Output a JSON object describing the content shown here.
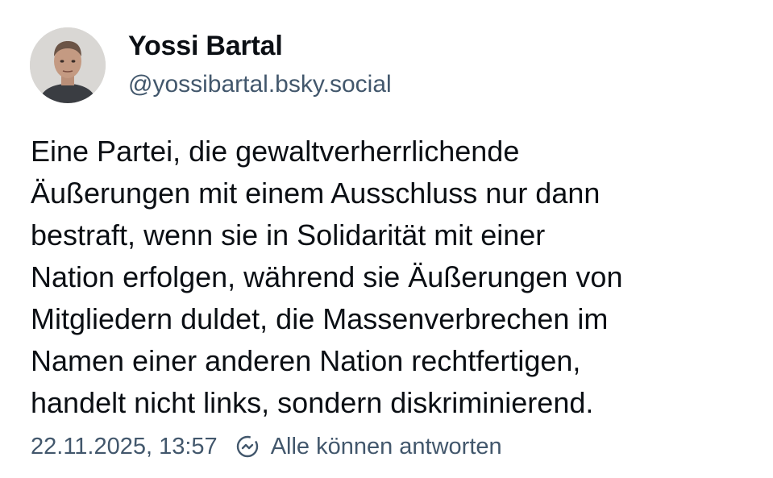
{
  "author": {
    "display_name": "Yossi Bartal",
    "handle": "@yossibartal.bsky.social",
    "avatar_icon": "user-avatar-photo"
  },
  "post": {
    "lines": [
      "Eine Partei, die gewaltverherrlichende",
      "Äußerungen mit einem Ausschluss nur dann",
      "bestraft, wenn sie in Solidarität mit einer",
      "Nation erfolgen, während sie Äußerungen von",
      "Mitgliedern duldet, die Massenverbrechen im",
      "Namen einer anderen Nation rechtfertigen,",
      "handelt nicht links, sondern diskriminierend."
    ]
  },
  "meta": {
    "timestamp": "22.11.2025, 13:57",
    "reply_setting_icon": "reply-settings-icon",
    "reply_setting": "Alle können antworten"
  },
  "colors": {
    "text": "#0b0f14",
    "secondary": "#42576c",
    "background": "#ffffff"
  }
}
